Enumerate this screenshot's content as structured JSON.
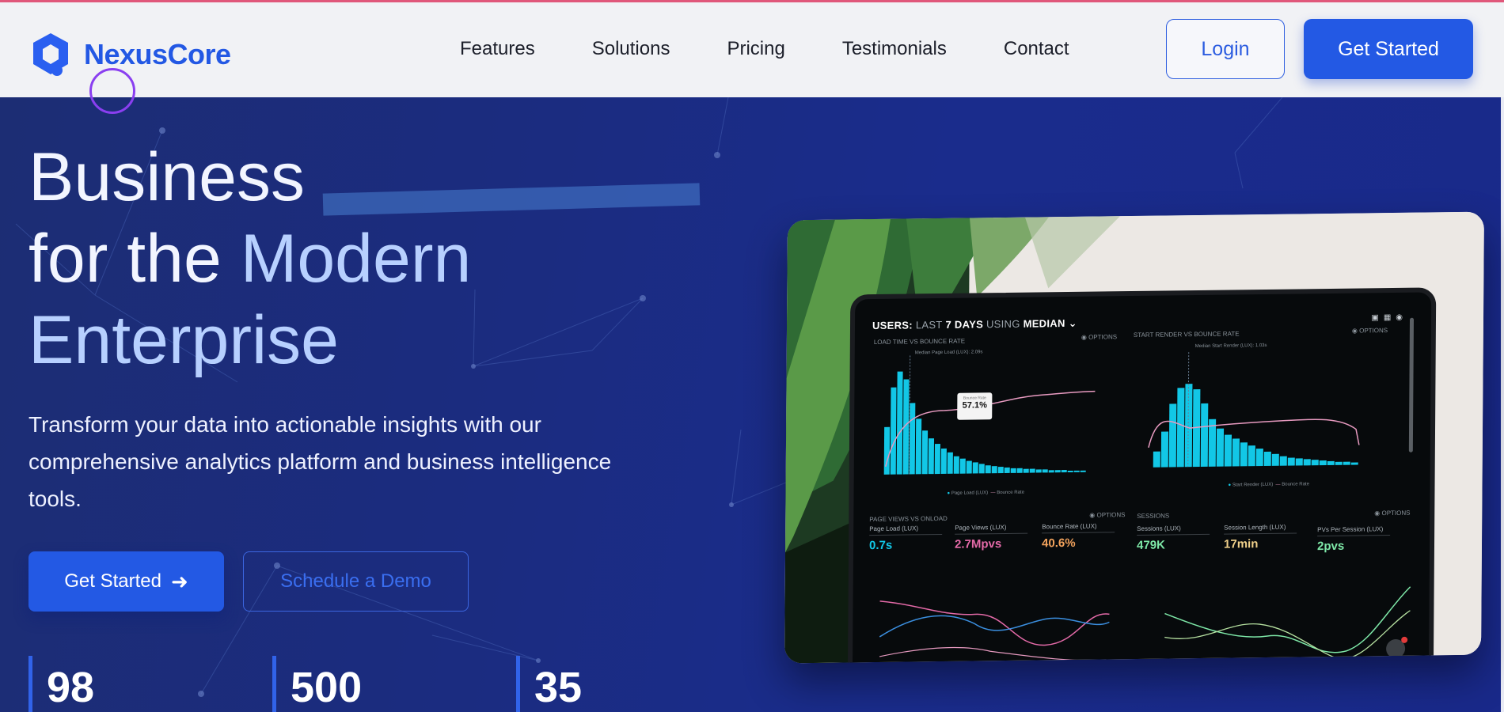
{
  "header": {
    "brand": "NexusCore",
    "nav": [
      "Features",
      "Solutions",
      "Pricing",
      "Testimonials",
      "Contact"
    ],
    "login_label": "Login",
    "get_started_label": "Get Started"
  },
  "hero": {
    "headline_line1": "Business",
    "headline_line2_a": "for the",
    "headline_line2_b": "Modern",
    "headline_line3": "Enterprise",
    "subtitle": "Transform your data into actionable insights with our comprehensive analytics platform and business intelligence tools.",
    "cta_primary": "Get Started",
    "cta_primary_icon": "arrow-right-icon",
    "cta_secondary": "Schedule a Demo",
    "stats": [
      "98",
      "500",
      "35"
    ]
  },
  "dashboard": {
    "title_a": "USERS:",
    "title_b": "LAST",
    "title_c": "7 DAYS",
    "title_d": "USING",
    "title_e": "MEDIAN",
    "pane1": "LOAD TIME VS BOUNCE RATE",
    "pane2": "START RENDER VS BOUNCE RATE",
    "pane3": "PAGE VIEWS VS ONLOAD",
    "pane4": "SESSIONS",
    "options": "OPTIONS",
    "median1": "Median Page Load (LUX): 2.09s",
    "median2": "Median Start Render (LUX): 1.03s",
    "tooltip_label": "Bounce Rate",
    "tooltip_value": "57.1%",
    "legend1a": "Page Load (LUX)",
    "legend1b": "Bounce Rate",
    "legend2a": "Start Render (LUX)",
    "legend2b": "Bounce Rate",
    "metrics": [
      {
        "label": "Page Load (LUX)",
        "value": "0.7s"
      },
      {
        "label": "Page Views (LUX)",
        "value": "2.7Mpvs"
      },
      {
        "label": "Bounce Rate (LUX)",
        "value": "40.6%"
      },
      {
        "label": "Sessions (LUX)",
        "value": "479K"
      },
      {
        "label": "Session Length (LUX)",
        "value": "17min"
      },
      {
        "label": "PVs Per Session (LUX)",
        "value": "2pvs"
      }
    ],
    "colors": {
      "cyan": "#12c7e6",
      "pink": "#e79ac0",
      "orange": "#f2a25c",
      "green": "#7ee8a8"
    }
  },
  "colors": {
    "accent": "#2359e4",
    "hero_bg": "#1b2c80",
    "brand": "#2358e4"
  }
}
